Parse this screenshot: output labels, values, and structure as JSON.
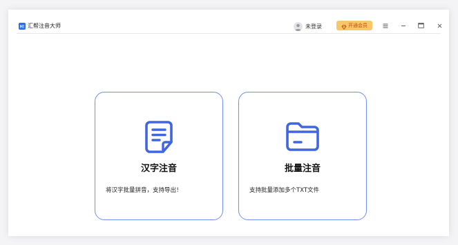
{
  "app": {
    "title": "汇帮注音大师"
  },
  "header": {
    "user_label": "未登录",
    "vip_label": "开通会员"
  },
  "window_controls": {
    "menu_icon": "menu-icon",
    "minimize_icon": "minimize-icon",
    "maximize_icon": "maximize-icon",
    "close_icon": "close-icon"
  },
  "cards": [
    {
      "icon": "document-icon",
      "title": "汉字注音",
      "description": "将汉字批量拼音，支持导出！"
    },
    {
      "icon": "folder-icon",
      "title": "批量注音",
      "description": "支持批量添加多个TXT文件"
    }
  ],
  "colors": {
    "accent": "#3f66e0",
    "card_border": "#6f8ff0",
    "vip_bg": "#f9c768",
    "vip_text": "#c2510d",
    "logo": "#2a6de8"
  }
}
